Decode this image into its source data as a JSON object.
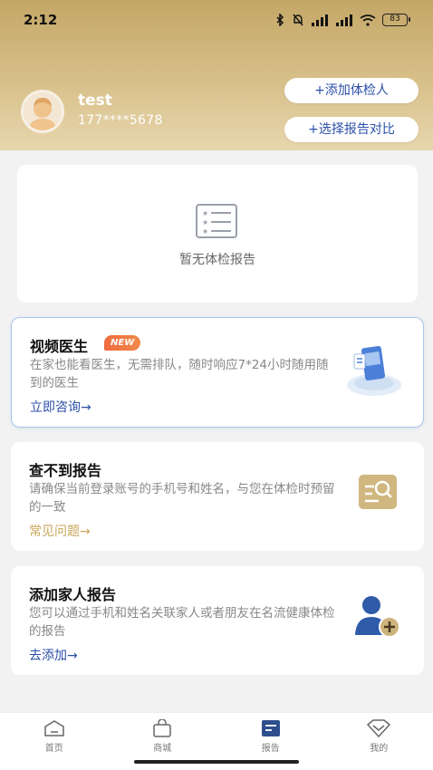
{
  "status_bar": {
    "time": "2:12",
    "battery": "83"
  },
  "user": {
    "name": "test",
    "phone": "177****5678"
  },
  "actions": {
    "add_examinee": "+添加体检人",
    "compare_reports": "+选择报告对比"
  },
  "empty_state": {
    "text": "暂无体检报告"
  },
  "cards": {
    "video": {
      "title": "视频医生",
      "badge": "NEW",
      "desc": "在家也能看医生，无需排队，随时响应7*24小时随用随到的医生",
      "link": "立即咨询→"
    },
    "report_missing": {
      "title": "查不到报告",
      "desc": "请确保当前登录账号的手机号和姓名，与您在体检时预留的一致",
      "link": "常见问题→"
    },
    "family": {
      "title": "添加家人报告",
      "desc": "您可以通过手机和姓名关联家人或者朋友在名流健康体检的报告",
      "link": "去添加→"
    }
  },
  "tabs": [
    {
      "label": "首页",
      "icon": "home-icon"
    },
    {
      "label": "商城",
      "icon": "bag-icon"
    },
    {
      "label": "报告",
      "icon": "report-icon"
    },
    {
      "label": "我的",
      "icon": "diamond-icon"
    }
  ],
  "colors": {
    "header_gold": "#c4a767",
    "link_blue": "#2b4fa8",
    "link_gold": "#c9a55a",
    "badge_orange": "#ef6a3e"
  }
}
